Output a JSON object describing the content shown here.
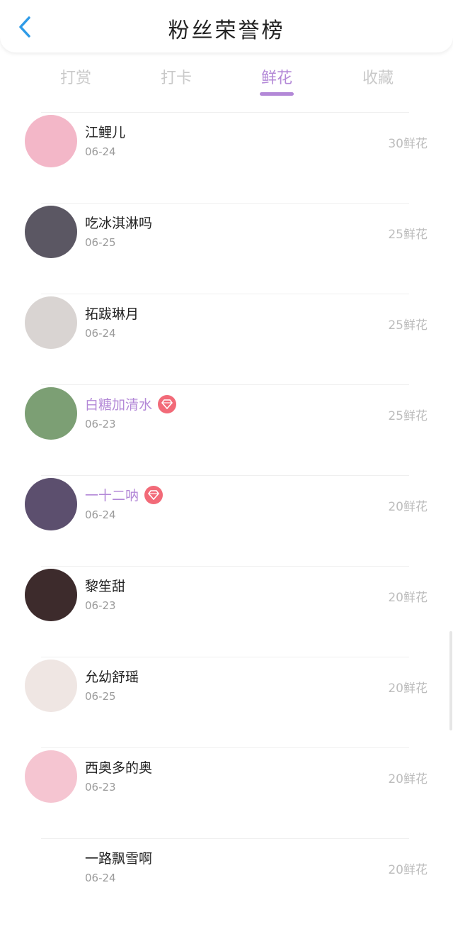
{
  "header": {
    "title": "粉丝荣誉榜",
    "back_icon": "chevron-left-icon",
    "back_color": "#2f9be7"
  },
  "tabs": [
    {
      "label": "打赏",
      "active": false
    },
    {
      "label": "打卡",
      "active": false
    },
    {
      "label": "鲜花",
      "active": true
    },
    {
      "label": "收藏",
      "active": false
    }
  ],
  "colors": {
    "accent": "#b388d7",
    "vip_badge": "#f26a78"
  },
  "list": [
    {
      "name": "江鲤儿",
      "date": "06-24",
      "count": "30鲜花",
      "vip": false,
      "avatar_color": "#f3b7c8"
    },
    {
      "name": "吃冰淇淋吗",
      "date": "06-25",
      "count": "25鲜花",
      "vip": false,
      "avatar_color": "#5b5763"
    },
    {
      "name": "拓跋琳月",
      "date": "06-24",
      "count": "25鲜花",
      "vip": false,
      "avatar_color": "#d9d4d2"
    },
    {
      "name": "白糖加清水",
      "date": "06-23",
      "count": "25鲜花",
      "vip": true,
      "avatar_color": "#7c9f74"
    },
    {
      "name": "一十二呐",
      "date": "06-24",
      "count": "20鲜花",
      "vip": true,
      "avatar_color": "#5c4f6e"
    },
    {
      "name": "黎笙甜",
      "date": "06-23",
      "count": "20鲜花",
      "vip": false,
      "avatar_color": "#3d2b2c"
    },
    {
      "name": "允幼舒瑶",
      "date": "06-25",
      "count": "20鲜花",
      "vip": false,
      "avatar_color": "#efe6e3"
    },
    {
      "name": "西奥多的奥",
      "date": "06-23",
      "count": "20鲜花",
      "vip": false,
      "avatar_color": "#f5c5d1"
    },
    {
      "name": "一路飘雪啊",
      "date": "06-24",
      "count": "20鲜花",
      "vip": false,
      "avatar_color": "#ffffff"
    }
  ]
}
